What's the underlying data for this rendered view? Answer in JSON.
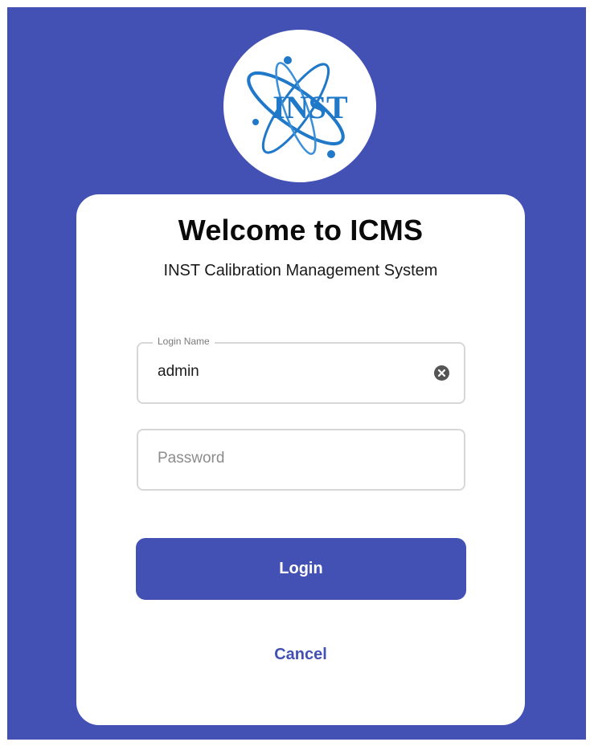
{
  "logo": {
    "text": "INST",
    "color": "#1f78c8"
  },
  "theme": {
    "primary": "#4351b4",
    "background": "#ffffff"
  },
  "header": {
    "title": "Welcome to ICMS",
    "subtitle": "INST Calibration Management System"
  },
  "form": {
    "login_name": {
      "label": "Login Name",
      "value": "admin",
      "clear_icon": "clear-icon"
    },
    "password": {
      "placeholder": "Password",
      "value": ""
    },
    "login_label": "Login",
    "cancel_label": "Cancel"
  }
}
